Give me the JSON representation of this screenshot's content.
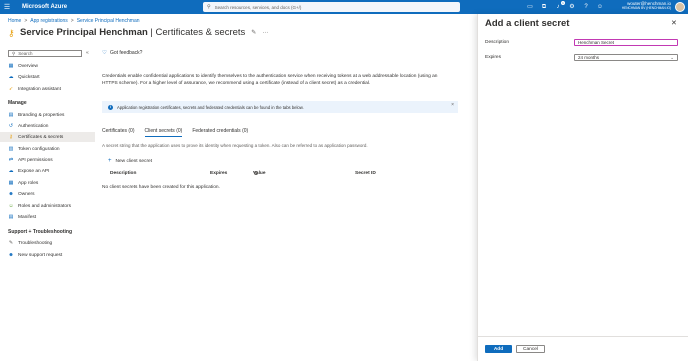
{
  "topbar": {
    "brand": "Microsoft Azure",
    "search_placeholder": "Search resources, services, and docs (G+/)",
    "notification_count": "1",
    "user_email": "wouter@henchman.io",
    "user_tenant": "HENCHMAN BV (HENCHMAN.IO)"
  },
  "breadcrumb": {
    "items": [
      "Home",
      "App registrations",
      "Service Principal Henchman"
    ],
    "separator": ">"
  },
  "header": {
    "title": "Service Principal Henchman",
    "subtitle": " | Certificates & secrets"
  },
  "sidebar": {
    "search_placeholder": "Search",
    "collapse": "«",
    "items_top": [
      {
        "label": "Overview",
        "icon": "overview-icon"
      },
      {
        "label": "Quickstart",
        "icon": "quickstart-icon"
      },
      {
        "label": "Integration assistant",
        "icon": "rocket-icon"
      }
    ],
    "manage_heading": "Manage",
    "manage_items": [
      {
        "label": "Branding & properties",
        "icon": "branding-icon"
      },
      {
        "label": "Authentication",
        "icon": "authentication-icon"
      },
      {
        "label": "Certificates & secrets",
        "icon": "key-icon",
        "active": true
      },
      {
        "label": "Token configuration",
        "icon": "token-icon"
      },
      {
        "label": "API permissions",
        "icon": "permissions-icon"
      },
      {
        "label": "Expose an API",
        "icon": "cloud-icon"
      },
      {
        "label": "App roles",
        "icon": "roles-icon"
      },
      {
        "label": "Owners",
        "icon": "owners-icon"
      },
      {
        "label": "Roles and administrators",
        "icon": "admin-icon"
      },
      {
        "label": "Manifest",
        "icon": "manifest-icon"
      }
    ],
    "support_heading": "Support + Troubleshooting",
    "support_items": [
      {
        "label": "Troubleshooting",
        "icon": "wrench-icon"
      },
      {
        "label": "New support request",
        "icon": "support-icon"
      }
    ]
  },
  "main": {
    "feedback_label": "Got feedback?",
    "intro_text": "Credentials enable confidential applications to identify themselves to the authentication service when receiving tokens at a web addressable location (using an HTTPS scheme). For a higher level of assurance, we recommend using a certificate (instead of a client secret) as a credential.",
    "info_text": "Application registration certificates, secrets and federated credentials can be found in the tabs below.",
    "tabs": [
      {
        "label": "Certificates (0)"
      },
      {
        "label": "Client secrets (0)",
        "active": true
      },
      {
        "label": "Federated credentials (0)"
      }
    ],
    "tab_description": "A secret string that the application uses to prove its identity when requesting a token. Also can be referred to as application password.",
    "new_secret_label": "New client secret",
    "table_headers": [
      "Description",
      "Expires",
      "Value",
      "Secret ID"
    ],
    "empty_message": "No client secrets have been created for this application."
  },
  "panel": {
    "title": "Add a client secret",
    "description_label": "Description",
    "description_value": "Henchman Secret",
    "expires_label": "Expires",
    "expires_value": "24 months",
    "add_label": "Add",
    "cancel_label": "Cancel"
  },
  "colors": {
    "accent": "#0f6cbd",
    "focus_border": "#c239b3"
  }
}
